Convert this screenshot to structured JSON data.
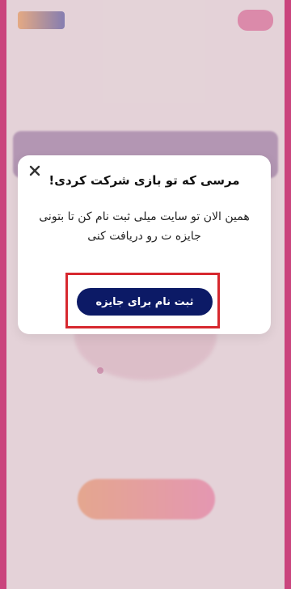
{
  "modal": {
    "title": "مرسی که تو بازی شرکت کردی!",
    "message": "همین الان تو سایت میلی ثبت نام کن تا بتونی جایزه ت رو دریافت کنی",
    "primary_button": "ثبت نام برای جایزه",
    "close_icon": "close-icon"
  },
  "colors": {
    "primary_button": "#0c1a66",
    "highlight_border": "#d7282f",
    "frame_accent": "#d6196b"
  }
}
